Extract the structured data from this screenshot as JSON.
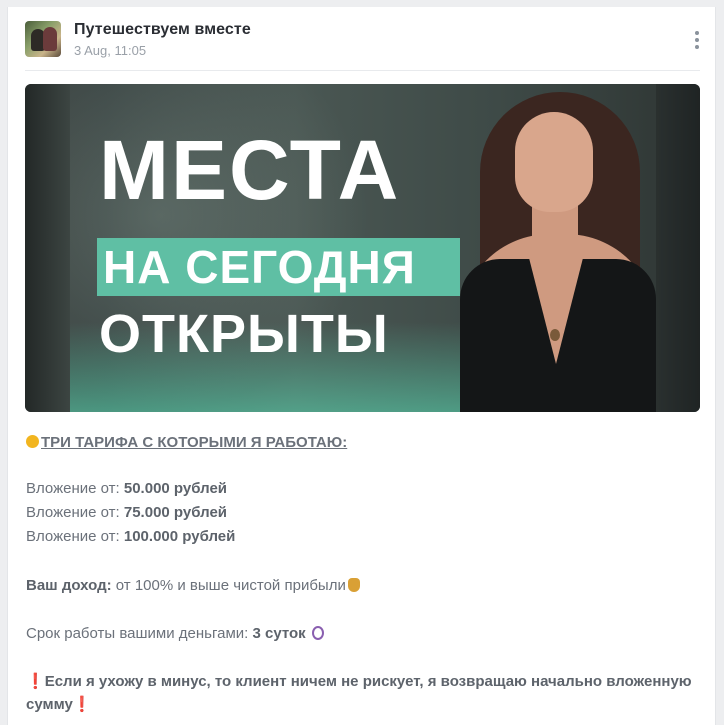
{
  "post": {
    "author": "Путешествуем вместе",
    "date": "3 Aug, 11:05"
  },
  "banner": {
    "line1": "МЕСТА",
    "line2": "НА СЕГОДНЯ",
    "line3": "ОТКРЫТЫ"
  },
  "body": {
    "heading": "ТРИ ТАРИФА С КОТОРЫМИ Я РАБОТАЮ:",
    "tariff_prefix": "Вложение от: ",
    "tariffs": [
      "50.000 рублей",
      "75.000 рублей",
      "100.000 рублей"
    ],
    "income_label": "Ваш доход:",
    "income_value": " от 100% и выше чистой прибыли",
    "term_label": "Срок работы вашими деньгами: ",
    "term_value": "3 суток",
    "warning_line1": "Если я ухожу в минус, то клиент ничем не рискует, я возвращаю начально вложенную",
    "warning_line2": "сумму"
  },
  "icons": {
    "menu": "more-vertical-icon",
    "coin": "coin-icon",
    "money_bag": "money-bag-icon",
    "stopwatch": "stopwatch-icon",
    "exclamation": "exclamation-icon"
  },
  "colors": {
    "accent_teal": "#5fbfa4",
    "warning_red": "#e0263a"
  }
}
